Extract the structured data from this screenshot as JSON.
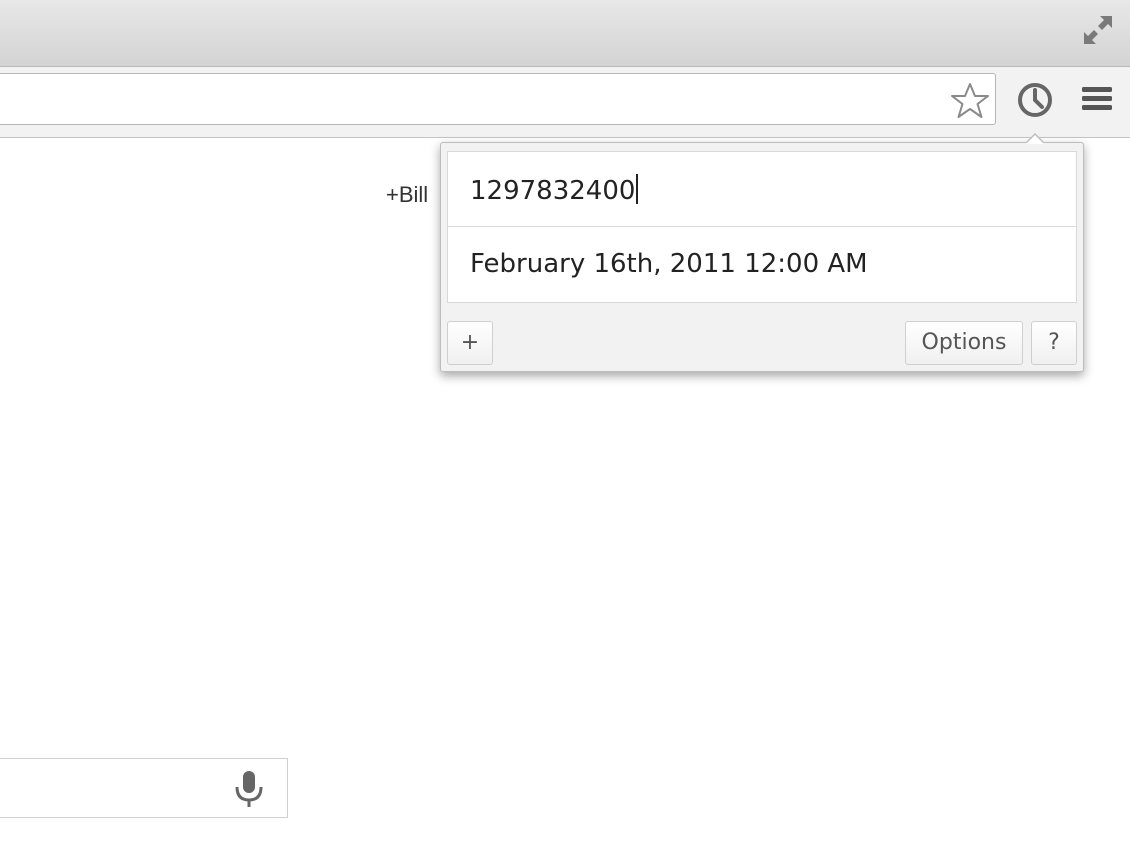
{
  "browser": {
    "fullscreen_icon": "fullscreen-icon",
    "star_icon": "star-icon",
    "extension_icon": "clock-icon",
    "menu_icon": "hamburger-menu-icon"
  },
  "page": {
    "user_link": "+Bill",
    "mic_icon": "microphone-icon"
  },
  "popup": {
    "timestamp_value": "1297832400",
    "converted_date": "February 16th, 2011 12:00 AM",
    "add_label": "+",
    "options_label": "Options",
    "help_label": "?"
  }
}
